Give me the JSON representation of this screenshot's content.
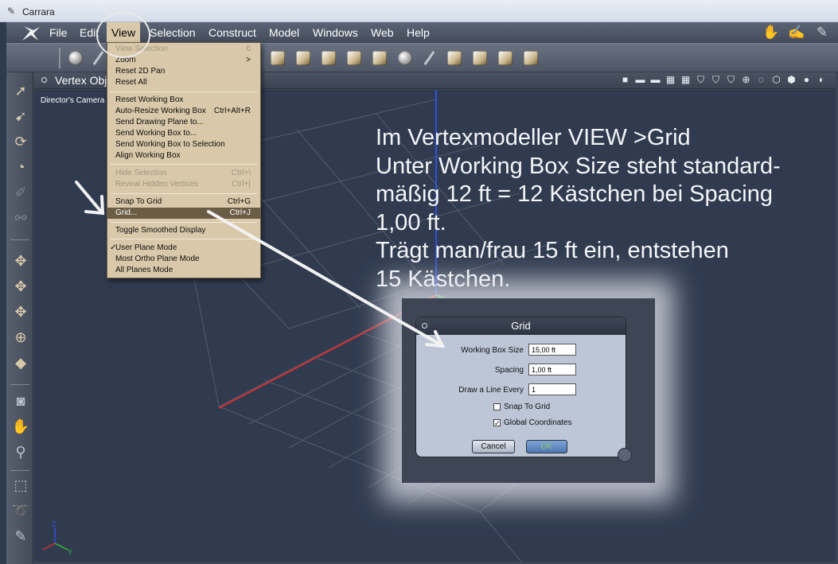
{
  "window": {
    "title": "Carrara",
    "icon": "app-icon"
  },
  "menubar": {
    "items": [
      {
        "label": "File"
      },
      {
        "label": "Edit"
      },
      {
        "label": "View"
      },
      {
        "label": "Selection"
      },
      {
        "label": "Construct"
      },
      {
        "label": "Model"
      },
      {
        "label": "Windows"
      },
      {
        "label": "Web"
      },
      {
        "label": "Help"
      }
    ],
    "active": "View"
  },
  "view_menu": {
    "items": [
      {
        "label": "View Selection",
        "shortcut": "0",
        "disabled": true
      },
      {
        "label": "Zoom",
        "shortcut": ">"
      },
      {
        "label": "Reset 2D Pan",
        "shortcut": ""
      },
      {
        "label": "Reset All",
        "shortcut": ""
      },
      {
        "label": "Reset Working Box",
        "shortcut": ""
      },
      {
        "label": "Auto-Resize Working Box",
        "shortcut": "Ctrl+Alt+R"
      },
      {
        "label": "Send Drawing Plane to...",
        "shortcut": ""
      },
      {
        "label": "Send Working Box to...",
        "shortcut": ""
      },
      {
        "label": "Send Working Box to Selection",
        "shortcut": ""
      },
      {
        "label": "Align Working Box",
        "shortcut": ""
      },
      {
        "label": "Hide Selection",
        "shortcut": "Ctrl+\\",
        "disabled": true
      },
      {
        "label": "Reveal Hidden Vertices",
        "shortcut": "Ctrl+|",
        "disabled": true
      },
      {
        "label": "Snap To Grid",
        "shortcut": "Ctrl+G"
      },
      {
        "label": "Grid...",
        "shortcut": "Ctrl+J",
        "highlighted": true
      },
      {
        "label": "Toggle Smoothed Display",
        "shortcut": ""
      },
      {
        "label": "User Plane Mode",
        "shortcut": "",
        "checked": true
      },
      {
        "label": "Most Ortho Plane Mode",
        "shortcut": ""
      },
      {
        "label": "All Planes Mode",
        "shortcut": ""
      }
    ],
    "check_mark": "✓"
  },
  "viewport": {
    "title": "Vertex Obj",
    "camera": "Director's Camera"
  },
  "axes": {
    "z": "Z",
    "y": "Y"
  },
  "annotation": {
    "lines": [
      "Im Vertexmodeller VIEW >Grid",
      "Unter Working Box Size steht standard-",
      "mäßig 12 ft = 12 Kästchen bei Spacing",
      "1,00 ft.",
      "Trägt man/frau 15 ft ein, entstehen",
      "15 Kästchen."
    ]
  },
  "grid_dialog": {
    "title": "Grid",
    "fields": [
      {
        "label": "Working Box Size",
        "value": "15,00 ft"
      },
      {
        "label": "Spacing",
        "value": "1,00 ft"
      },
      {
        "label": "Draw a Line Every",
        "value": "1"
      }
    ],
    "checkboxes": [
      {
        "label": "Snap To Grid",
        "checked": false
      },
      {
        "label": "Global Coordinates",
        "checked": true
      }
    ],
    "cancel_label": "Cancel",
    "ok_label": "OK"
  },
  "colors": {
    "menu_bg": "#d9c9aa",
    "menu_highlight": "#6b5c45",
    "viewport_bg": "#303b50",
    "axis_x": "#d03030",
    "axis_y": "#30c030",
    "axis_z": "#3050e0"
  }
}
